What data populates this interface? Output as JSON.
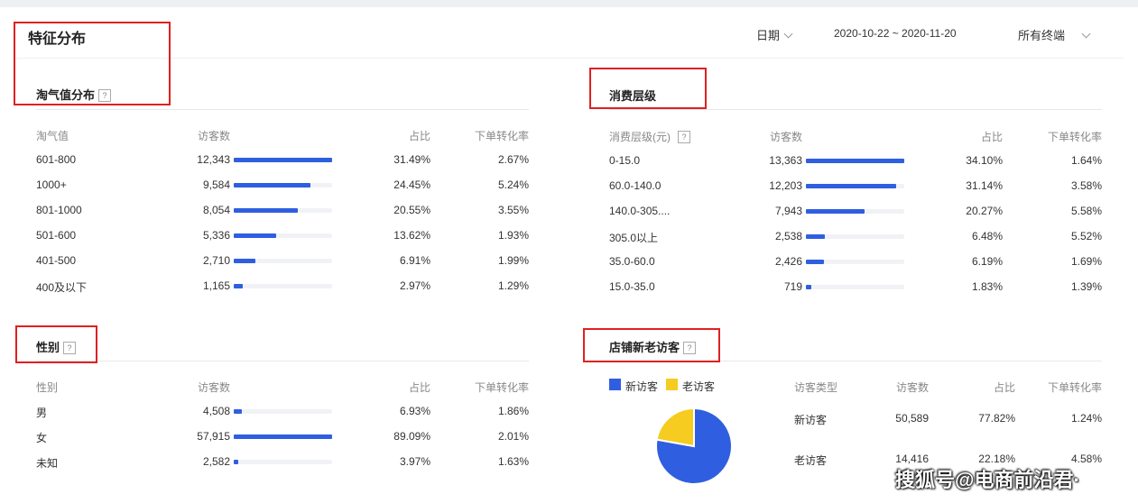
{
  "page": {
    "title": "特征分布"
  },
  "filters": {
    "date_label": "日期",
    "date_range": "2020-10-22 ~ 2020-11-20",
    "terminal": "所有终端"
  },
  "taoqi": {
    "title": "淘气值分布",
    "headers": [
      "淘气值",
      "访客数",
      "占比",
      "下单转化率"
    ],
    "rows": [
      {
        "label": "601-800",
        "visitors": "12,343",
        "share": "31.49%",
        "conv": "2.67%",
        "bar": 1.0
      },
      {
        "label": "1000+",
        "visitors": "9,584",
        "share": "24.45%",
        "conv": "5.24%",
        "bar": 0.776
      },
      {
        "label": "801-1000",
        "visitors": "8,054",
        "share": "20.55%",
        "conv": "3.55%",
        "bar": 0.652
      },
      {
        "label": "501-600",
        "visitors": "5,336",
        "share": "13.62%",
        "conv": "1.93%",
        "bar": 0.432
      },
      {
        "label": "401-500",
        "visitors": "2,710",
        "share": "6.91%",
        "conv": "1.99%",
        "bar": 0.219
      },
      {
        "label": "400及以下",
        "visitors": "1,165",
        "share": "2.97%",
        "conv": "1.29%",
        "bar": 0.094
      }
    ]
  },
  "consume": {
    "title": "消费层级",
    "headers": [
      "消费层级(元)",
      "访客数",
      "占比",
      "下单转化率"
    ],
    "rows": [
      {
        "label": "0-15.0",
        "visitors": "13,363",
        "share": "34.10%",
        "conv": "1.64%",
        "bar": 1.0
      },
      {
        "label": "60.0-140.0",
        "visitors": "12,203",
        "share": "31.14%",
        "conv": "3.58%",
        "bar": 0.913
      },
      {
        "label": "140.0-305....",
        "visitors": "7,943",
        "share": "20.27%",
        "conv": "5.58%",
        "bar": 0.594
      },
      {
        "label": "305.0以上",
        "visitors": "2,538",
        "share": "6.48%",
        "conv": "5.52%",
        "bar": 0.19
      },
      {
        "label": "35.0-60.0",
        "visitors": "2,426",
        "share": "6.19%",
        "conv": "1.69%",
        "bar": 0.182
      },
      {
        "label": "15.0-35.0",
        "visitors": "719",
        "share": "1.83%",
        "conv": "1.39%",
        "bar": 0.054
      }
    ]
  },
  "gender": {
    "title": "性别",
    "headers": [
      "性别",
      "访客数",
      "占比",
      "下单转化率"
    ],
    "rows": [
      {
        "label": "男",
        "visitors": "4,508",
        "share": "6.93%",
        "conv": "1.86%",
        "bar": 0.078
      },
      {
        "label": "女",
        "visitors": "57,915",
        "share": "89.09%",
        "conv": "2.01%",
        "bar": 1.0
      },
      {
        "label": "未知",
        "visitors": "2,582",
        "share": "3.97%",
        "conv": "1.63%",
        "bar": 0.045
      }
    ]
  },
  "store": {
    "title": "店铺新老访客",
    "legend": [
      "新访客",
      "老访客"
    ],
    "headers": [
      "访客类型",
      "访客数",
      "占比",
      "下单转化率"
    ],
    "rows": [
      {
        "label": "新访客",
        "visitors": "50,589",
        "share": "77.82%",
        "conv": "1.24%"
      },
      {
        "label": "老访客",
        "visitors": "14,416",
        "share": "22.18%",
        "conv": "4.58%"
      }
    ],
    "pie": [
      0.7782,
      0.2218
    ],
    "colors": [
      "#2f5fe0",
      "#f5cc1f"
    ]
  },
  "watermark": "搜狐号@电商前沿君·",
  "colors": {
    "bar": "#2f5fe0",
    "highlight": "#e02020"
  }
}
